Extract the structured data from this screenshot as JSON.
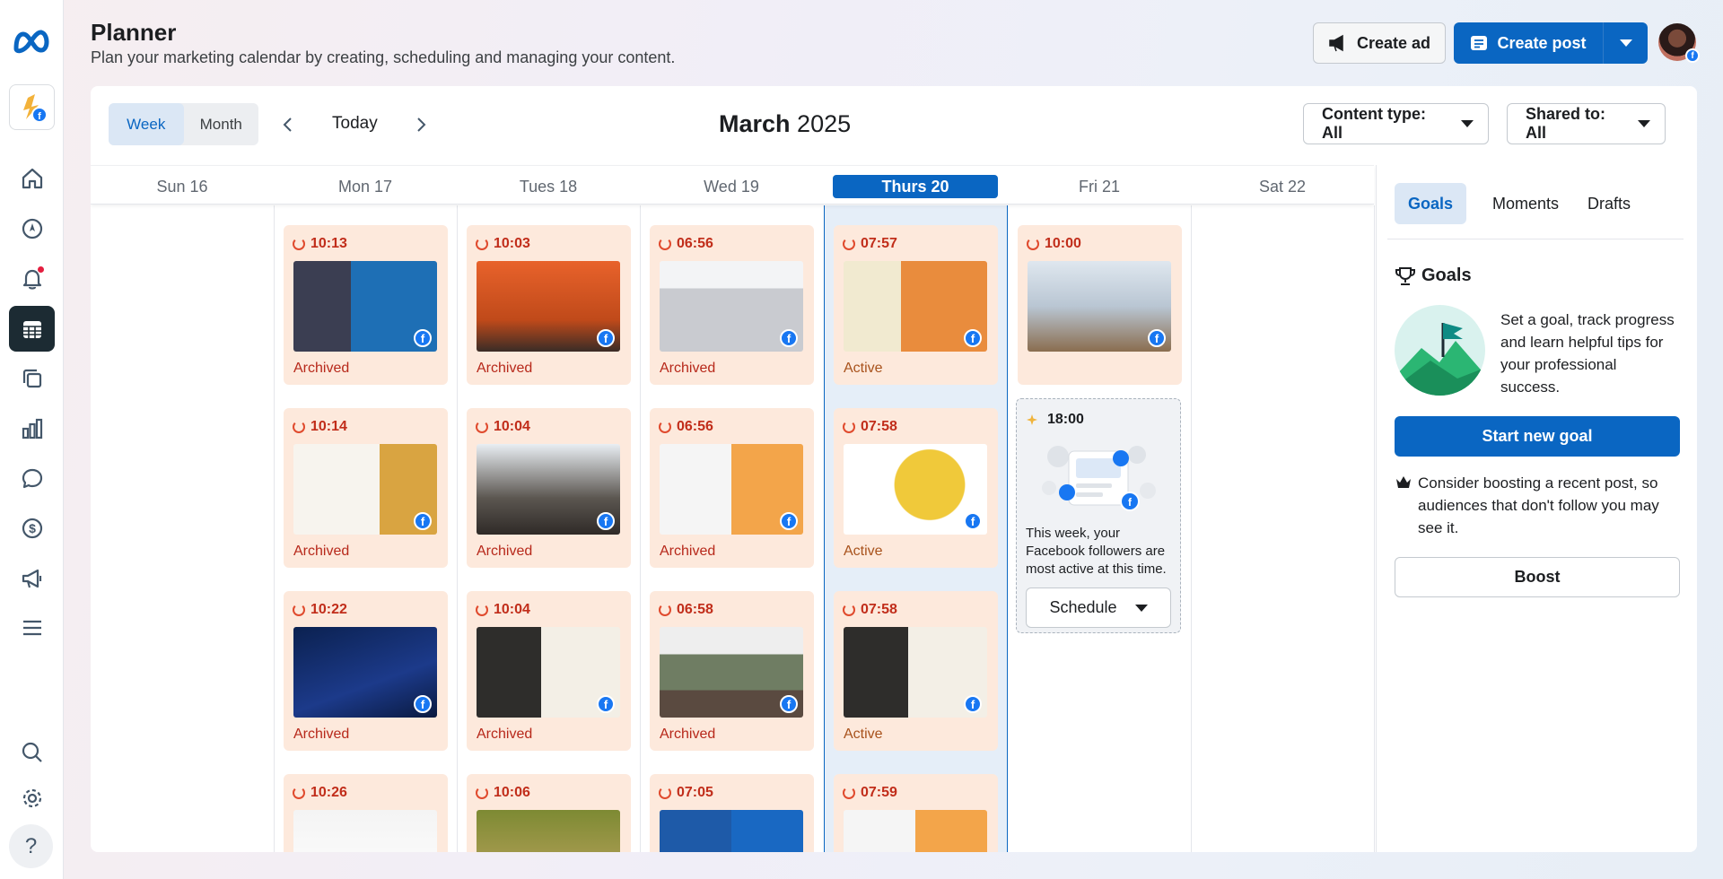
{
  "app": {
    "name": "Meta Business Suite"
  },
  "header": {
    "title": "Planner",
    "subtitle": "Plan your marketing calendar by creating, scheduling and managing your content.",
    "create_ad": "Create ad",
    "create_post": "Create post"
  },
  "toolbar": {
    "week": "Week",
    "month": "Month",
    "today": "Today",
    "month_name": "March",
    "year": "2025",
    "content_type": "Content type: All",
    "shared_to": "Shared to: All"
  },
  "days": [
    "Sun 16",
    "Mon 17",
    "Tues 18",
    "Wed 19",
    "Thurs 20",
    "Fri 21",
    "Sat 22"
  ],
  "today_index": 4,
  "posts": [
    {
      "day": 1,
      "row": 0,
      "time": "10:13",
      "status": "Archived",
      "thumb": "blue"
    },
    {
      "day": 1,
      "row": 1,
      "time": "10:14",
      "status": "Archived",
      "thumb": "letter"
    },
    {
      "day": 1,
      "row": 2,
      "time": "10:22",
      "status": "Archived",
      "thumb": "navy"
    },
    {
      "day": 1,
      "row": 3,
      "time": "10:26",
      "status": "",
      "thumb": "news"
    },
    {
      "day": 2,
      "row": 0,
      "time": "10:03",
      "status": "Archived",
      "thumb": "orange"
    },
    {
      "day": 2,
      "row": 1,
      "time": "10:04",
      "status": "Archived",
      "thumb": "hands"
    },
    {
      "day": 2,
      "row": 2,
      "time": "10:04",
      "status": "Archived",
      "thumb": "hub"
    },
    {
      "day": 2,
      "row": 3,
      "time": "10:06",
      "status": "",
      "thumb": "green"
    },
    {
      "day": 3,
      "row": 0,
      "time": "06:56",
      "status": "Archived",
      "thumb": "pen"
    },
    {
      "day": 3,
      "row": 1,
      "time": "06:56",
      "status": "Archived",
      "thumb": "tools"
    },
    {
      "day": 3,
      "row": 2,
      "time": "06:58",
      "status": "Archived",
      "thumb": "crowd"
    },
    {
      "day": 3,
      "row": 3,
      "time": "07:05",
      "status": "",
      "thumb": "quote"
    },
    {
      "day": 4,
      "row": 0,
      "time": "07:57",
      "status": "Active",
      "thumb": "people"
    },
    {
      "day": 4,
      "row": 1,
      "time": "07:58",
      "status": "Active",
      "thumb": "yellow"
    },
    {
      "day": 4,
      "row": 2,
      "time": "07:58",
      "status": "Active",
      "thumb": "hub"
    },
    {
      "day": 4,
      "row": 3,
      "time": "07:59",
      "status": "",
      "thumb": "tools"
    },
    {
      "day": 5,
      "row": 0,
      "time": "10:00",
      "status": "",
      "thumb": "court"
    }
  ],
  "suggestion": {
    "time": "18:00",
    "text": "This week, your Facebook followers are most active at this time.",
    "button": "Schedule"
  },
  "right_panel": {
    "tabs": [
      "Goals",
      "Moments",
      "Drafts"
    ],
    "goals_heading": "Goals",
    "goals_text": "Set a goal, track progress and learn helpful tips for your professional success.",
    "start_goal": "Start new goal",
    "boost_text": "Consider boosting a recent post, so audiences that don't follow you may see it.",
    "boost_button": "Boost"
  },
  "colors": {
    "accent": "#0a66c2",
    "post_bg": "#fde9dc",
    "status": "#b7281a",
    "rail_active": "#1c2b33"
  },
  "rail_icons": [
    "home-icon",
    "explore-icon",
    "notifications-icon",
    "planner-icon",
    "content-icon",
    "insights-icon",
    "inbox-icon",
    "monetization-icon",
    "ads-icon",
    "menu-icon",
    "search-icon",
    "settings-icon",
    "help-icon"
  ]
}
